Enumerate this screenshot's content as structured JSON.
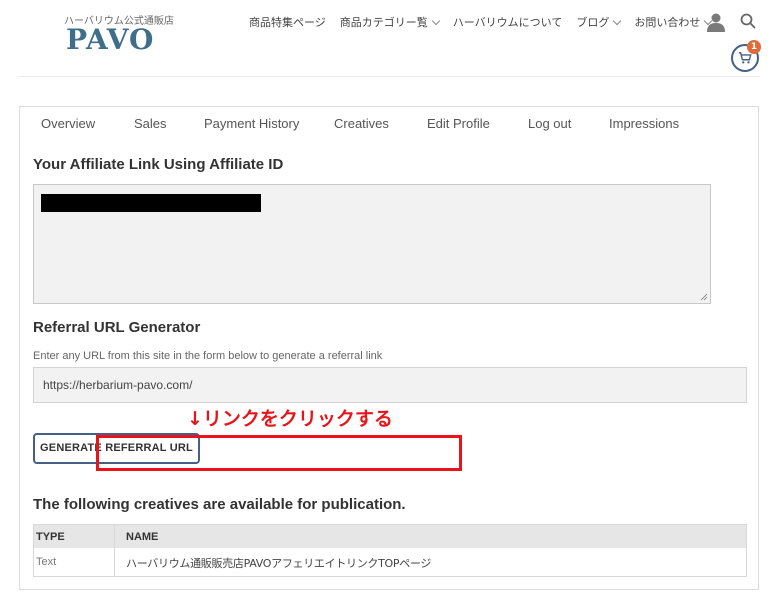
{
  "header": {
    "logo_tagline": "ハーバリウム公式通販店",
    "logo_text": "PAVO",
    "nav": [
      {
        "label": "商品特集ページ",
        "has_dropdown": false
      },
      {
        "label": "商品カテゴリー覧",
        "has_dropdown": true
      },
      {
        "label": "ハーバリウムについて",
        "has_dropdown": false
      },
      {
        "label": "ブログ",
        "has_dropdown": true
      },
      {
        "label": "お問い合わせ",
        "has_dropdown": true
      }
    ],
    "icons": {
      "user": "user-icon",
      "search": "search-icon",
      "cart": "cart-icon"
    },
    "cart_count": "1",
    "accent_color": "#446084",
    "badge_color": "#e06a38"
  },
  "tabs": [
    "Overview",
    "Sales",
    "Payment History",
    "Creatives",
    "Edit Profile",
    "Log out",
    "Impressions"
  ],
  "affiliate": {
    "heading": "Your Affiliate Link Using Affiliate ID"
  },
  "referral": {
    "heading": "Referral URL Generator",
    "hint": "Enter any URL from this site in the form below to generate a referral link",
    "url_value": "https://herbarium-pavo.com/",
    "button_label": "GENERATE REFERRAL URL"
  },
  "creatives": {
    "heading": "The following creatives are available for publication.",
    "columns": [
      "TYPE",
      "NAME"
    ],
    "rows": [
      {
        "type": "Text",
        "name": "ハーバリウム通販販売店PAVOアフェリエイトリンクTOPページ"
      }
    ]
  },
  "annotation": {
    "text": "↓リンクをクリックする",
    "color": "#e8141a"
  }
}
